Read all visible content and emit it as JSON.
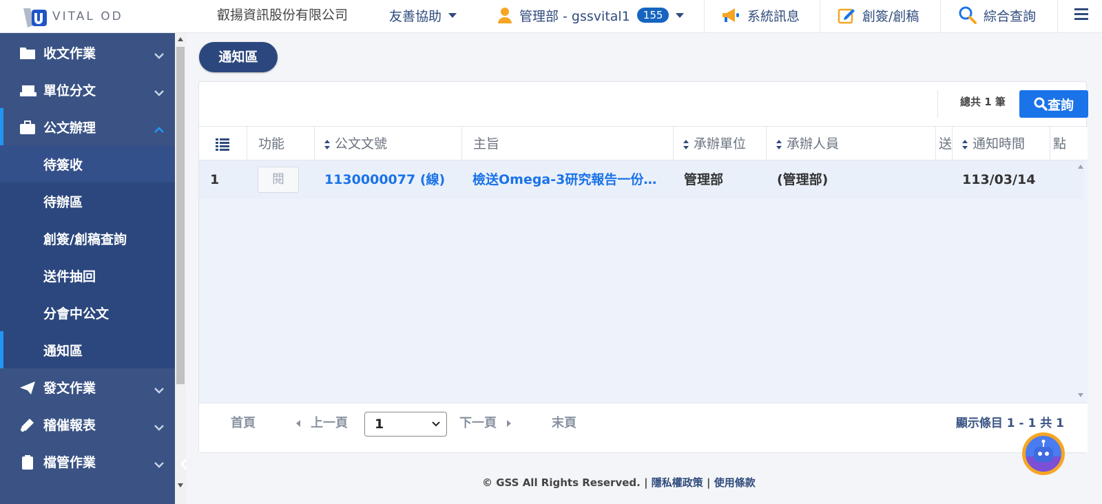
{
  "brand": {
    "logo_text": "VITAL OD",
    "company": "叡揚資訊股份有限公司"
  },
  "topnav": {
    "accessibility": "友善協助",
    "user": "管理部 - gssvital1",
    "badge": "155",
    "messages": "系統訊息",
    "draft": "創簽/創稿",
    "search": "綜合查詢"
  },
  "sidebar": {
    "items": [
      {
        "label": "收文作業",
        "icon": "folder-icon"
      },
      {
        "label": "單位分文",
        "icon": "inbox-icon"
      },
      {
        "label": "公文辦理",
        "icon": "briefcase-icon"
      },
      {
        "label": "待簽收"
      },
      {
        "label": "待辦區"
      },
      {
        "label": "創簽/創稿查詢"
      },
      {
        "label": "送件抽回"
      },
      {
        "label": "分會中公文"
      },
      {
        "label": "通知區"
      },
      {
        "label": "發文作業",
        "icon": "paper-plane-icon"
      },
      {
        "label": "稽催報表",
        "icon": "bullhorn-icon"
      },
      {
        "label": "檔管作業",
        "icon": "clipboard-icon"
      }
    ]
  },
  "page": {
    "title": "通知區"
  },
  "toolbar": {
    "total": "總共 1 筆",
    "query": "查詢"
  },
  "table": {
    "headers": {
      "func": "功能",
      "doc_no": "公文文號",
      "subject": "主旨",
      "unit": "承辦單位",
      "person": "承辦人員",
      "col_x": "送",
      "time": "通知時間",
      "col_y": "點"
    },
    "rows": [
      {
        "index": "1",
        "func": "閱",
        "doc_no": "1130000077 (線)",
        "subject": "檢送Omega-3研究報告一份…",
        "unit": "管理部",
        "person": "(管理部)",
        "time": "113/03/14"
      }
    ]
  },
  "pager": {
    "first": "首頁",
    "prev": "上一頁",
    "page": "1",
    "next": "下一頁",
    "last": "末頁",
    "info": "顯示條目 1 - 1 共 1"
  },
  "footer": {
    "copyright": "© GSS All Rights Reserved. |",
    "privacy": "隱私權政策",
    "sep": "|",
    "terms": "使用條款"
  },
  "colors": {
    "primary": "#2b477d",
    "sidebar": "#3a5384",
    "link": "#1a73e8",
    "accent": "#2196f3"
  }
}
